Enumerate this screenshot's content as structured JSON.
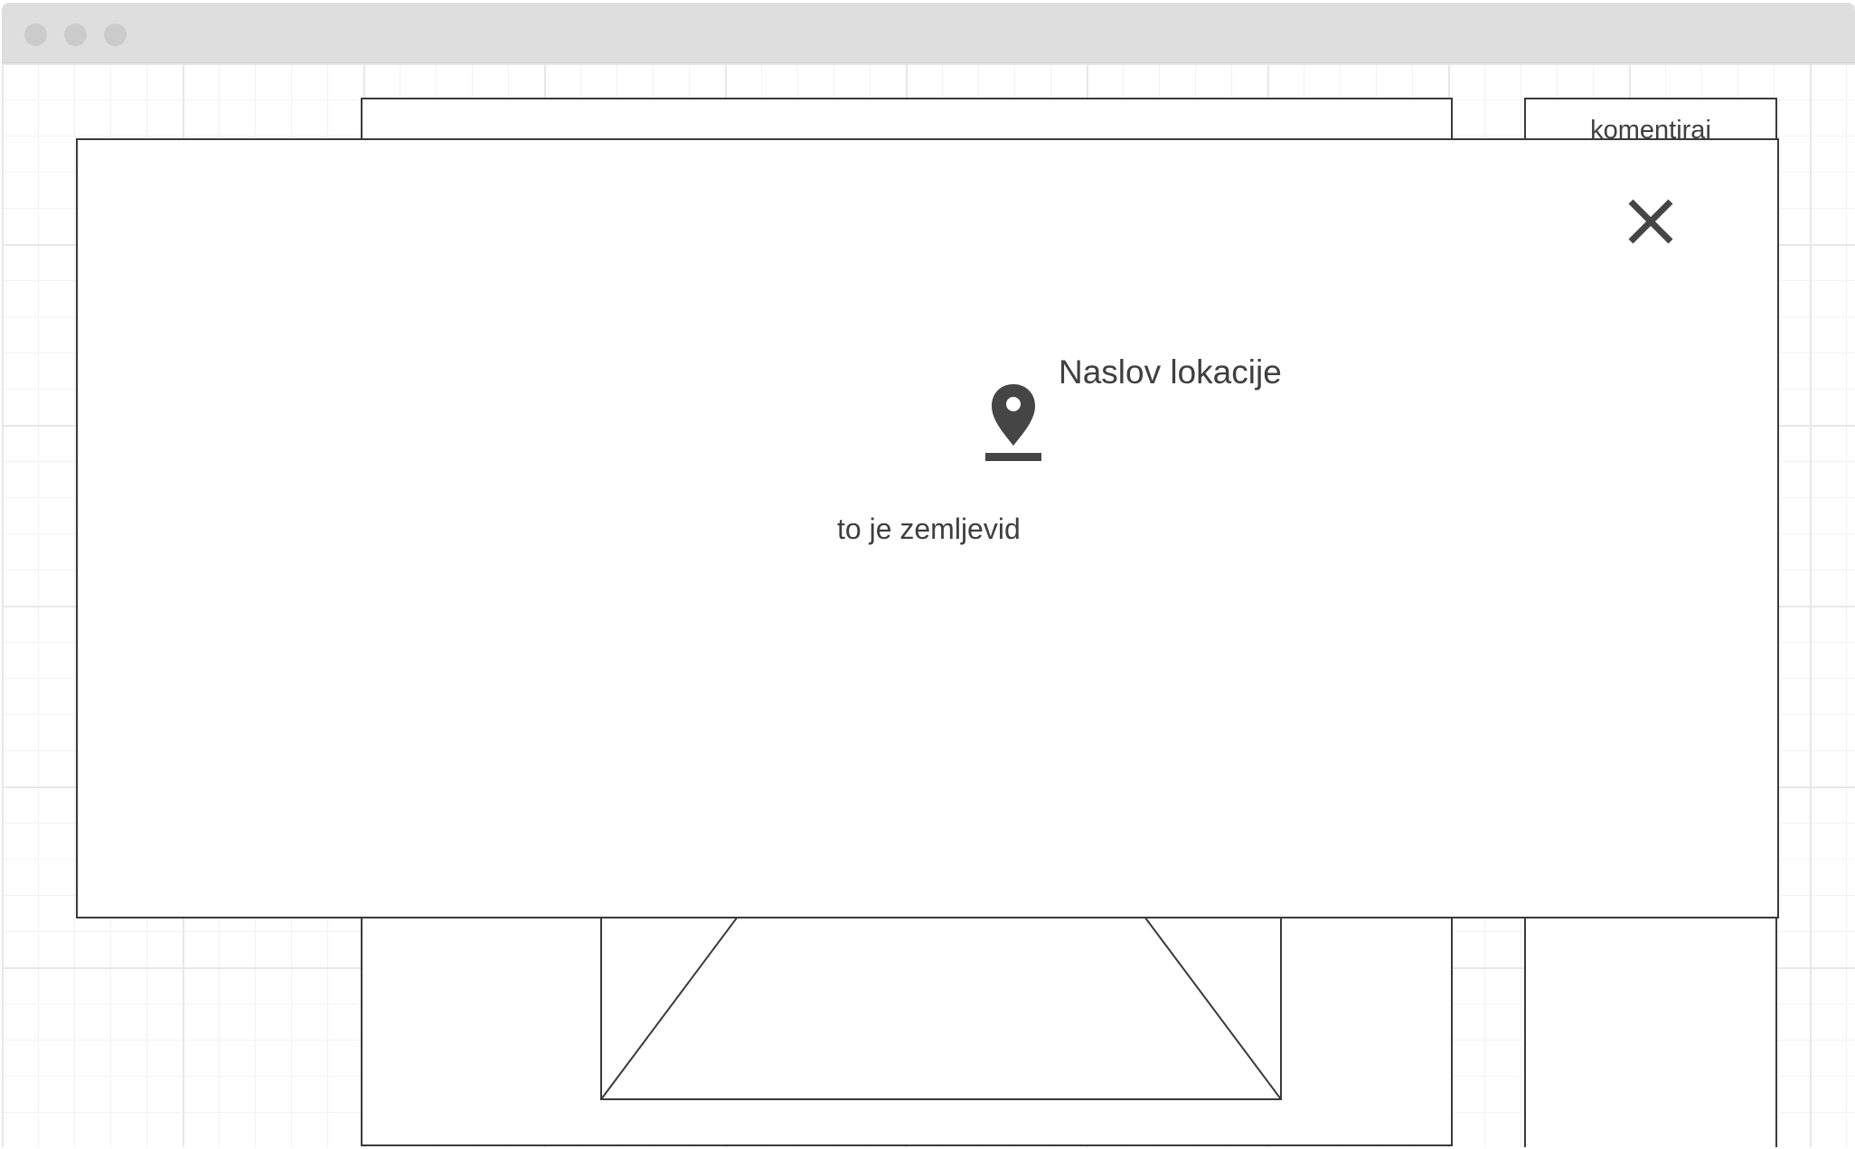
{
  "window": {
    "controls": [
      "close-dot",
      "minimize-dot",
      "maximize-dot"
    ]
  },
  "sidebar": {
    "label": "komentiraj"
  },
  "modal": {
    "location_title": "Naslov lokacije",
    "map_text": "to je zemljevid",
    "close_icon": "close-icon",
    "pin_icon": "location-pin-icon"
  },
  "colors": {
    "stroke": "#3a3a3a",
    "text": "#3f3f3f",
    "titlebar": "#dedede",
    "grid": "#e7e7e7"
  }
}
